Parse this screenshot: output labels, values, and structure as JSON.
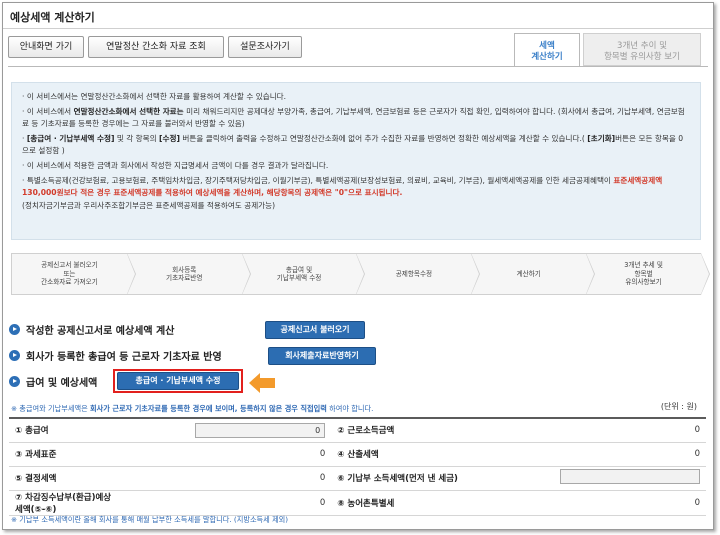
{
  "window": {
    "title": "예상세액 계산하기"
  },
  "toolbar": {
    "home_label": "안내화면 가기",
    "simplified_label": "연말정산 간소화 자료 조회",
    "survey_label": "설문조사가기"
  },
  "tabs": [
    {
      "label": "세액\n계산하기"
    },
    {
      "label": "3개년 추이 및\n항목별 유의사항 보기"
    }
  ],
  "info": {
    "items": [
      {
        "text": "이 서비스에서는 연말정산간소화에서 선택한 자료를 활용하여 계산할 수 있습니다."
      },
      {
        "text_a": "이 서비스에서 ",
        "text_b": "연말정산간소화에서 선택한 자료는",
        "text_c": " 미리 채워드리지만 공제대상 부양가족, 총급여, 기납부세액, 연금보험료 등은 근로자가 직접 확인, 입력하여야 합니다. (회사에서 총급여, 기납부세액, 연금보험료 등 기초자료를 등록한 경우에는 그 자료를 불러와서 반영할 수 있음)"
      },
      {
        "text_a": "[총급여 · 기납부세액 수정]",
        "text_b": " 및 각 항목의 ",
        "text_c": "[수정]",
        "text_d": " 버튼을 클릭하여 출력을 수정하고 연말정산간소화에 없어 추가 수집한 자료를 반영하면 정확한 예상세액을 계산할 수 있습니다.( ",
        "text_e": "[초기화]",
        "text_f": "버튼은 모든 항목을 0으로 설정함 )"
      },
      {
        "text": "이 서비스에서 적용한 금액과 회사에서 작성한 지급명세서 금액이 다를 경우 결과가 달라집니다."
      },
      {
        "text_a": "특별소득공제(건강보험료, 고용보험료, 주택임차차입금, 장기주택저당차입금, 이월기부금), 특별세액공제(보장성보험료, 의료비, 교육비, 기부금), 월세액세액공제를 인한 세금공제혜택이 ",
        "text_b": "표준세액공제액 130,000원보다 적은 경우 표준세액공제를 적용하여 예상세액을 계산하며, 해당항목의 공제액은 \"0\"으로 표시됩니다.",
        "text_c": "(정치자금기부금과 우리사주조합기부금은 표준세액공제를 적용하여도 공제가능)"
      }
    ]
  },
  "steps": [
    {
      "label": "공제신고서 불러오기\n또는\n간소화자료 가져오기"
    },
    {
      "label": "회사등록\n기초자료반영"
    },
    {
      "label": "총급여 및\n기납부세액 수정"
    },
    {
      "label": "공제항목수정"
    },
    {
      "label": "계산하기"
    },
    {
      "label": "3개년 추세 및\n항목별\n유의사항보기"
    }
  ],
  "sections": {
    "s1_label": "작성한 공제신고서로 예상세액 계산",
    "s1_button": "공제신고서 불러오기",
    "s2_label": "회사가 등록한 총급여 등 근로자 기초자료 반영",
    "s2_button": "회사제출자료반영하기",
    "s3_label": "급여 및 예상세액",
    "s3_button": "총급여 · 기납부세액 수정"
  },
  "note": {
    "a": "※ 총급여와 기납부세액은 ",
    "b": "회사가 근로자 기초자료를 등록한 경우에 보이며, 등록하지 않은 경우 직접입력",
    "c": " 하여야 합니다.",
    "unit": "(단위 : 원)"
  },
  "table": {
    "rows": [
      {
        "l_label": "① 총급여",
        "l_value": "0",
        "r_label": "② 근로소득금액",
        "r_value": "0"
      },
      {
        "l_label": "③ 과세표준",
        "l_value": "0",
        "r_label": "④ 산출세액",
        "r_value": "0"
      },
      {
        "l_label": "⑤ 결정세액",
        "l_value": "0",
        "r_label": "⑥ 기납부 소득세액(먼저 낸 세금)",
        "r_value": ""
      },
      {
        "l_label": "⑦ 차감징수납부(환급)예상세액(⑤-⑥)",
        "l_value": "0",
        "r_label": "⑧ 농어촌특별세",
        "r_value": "0"
      }
    ]
  },
  "footer": {
    "text": "※ 기납부 소득세액이란 올해 회사를 통해 매월 납부한 소득세를 말합니다. (지방소득세 제외)"
  },
  "colors": {
    "accent": "#2c6db2",
    "highlight": "#e2201d",
    "arrow": "#f39a2b",
    "info_bg": "#e9f1f7"
  }
}
